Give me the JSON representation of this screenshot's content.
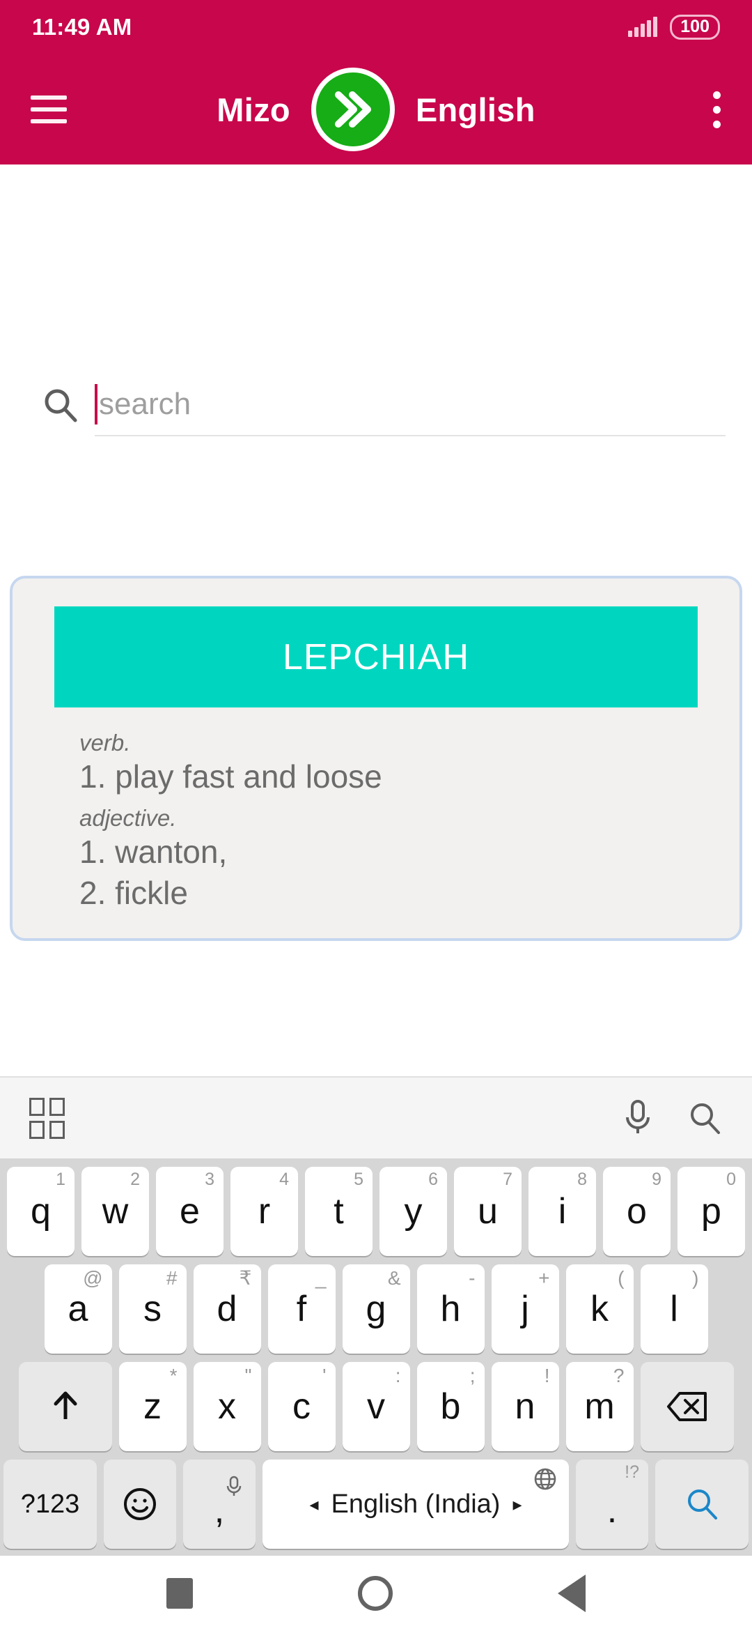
{
  "status_bar": {
    "time": "11:49 AM",
    "battery_level": "100",
    "signal_icon": "signal-bars-icon",
    "battery_icon": "battery-icon"
  },
  "app_bar": {
    "menu_icon": "hamburger-menu-icon",
    "source_language": "Mizo",
    "swap_icon": "double-chevron-right-icon",
    "target_language": "English",
    "overflow_icon": "more-vertical-icon",
    "background_color": "#c8064b",
    "swap_button_color": "#16ad16"
  },
  "search": {
    "icon": "search-icon",
    "placeholder": "search",
    "value": "",
    "caret_color": "#c8064b"
  },
  "result_card": {
    "headword": "LEPCHIAH",
    "header_color": "#00d6bf",
    "card_background": "#f2f1ef",
    "border_color": "#c6d7ef",
    "entries": [
      {
        "pos": "verb.",
        "senses": [
          "1. play fast and loose"
        ]
      },
      {
        "pos": "adjective.",
        "senses": [
          "1. wanton,",
          "2. fickle"
        ]
      }
    ]
  },
  "keyboard": {
    "toolbar": {
      "grid_icon": "grid-squares-icon",
      "mic_icon": "microphone-icon",
      "search_icon": "search-icon"
    },
    "row1": [
      {
        "key": "q",
        "hint": "1"
      },
      {
        "key": "w",
        "hint": "2"
      },
      {
        "key": "e",
        "hint": "3"
      },
      {
        "key": "r",
        "hint": "4"
      },
      {
        "key": "t",
        "hint": "5"
      },
      {
        "key": "y",
        "hint": "6"
      },
      {
        "key": "u",
        "hint": "7"
      },
      {
        "key": "i",
        "hint": "8"
      },
      {
        "key": "o",
        "hint": "9"
      },
      {
        "key": "p",
        "hint": "0"
      }
    ],
    "row2": [
      {
        "key": "a",
        "hint": "@"
      },
      {
        "key": "s",
        "hint": "#"
      },
      {
        "key": "d",
        "hint": "₹"
      },
      {
        "key": "f",
        "hint": "_"
      },
      {
        "key": "g",
        "hint": "&"
      },
      {
        "key": "h",
        "hint": "-"
      },
      {
        "key": "j",
        "hint": "+"
      },
      {
        "key": "k",
        "hint": "("
      },
      {
        "key": "l",
        "hint": ")"
      }
    ],
    "row3": [
      {
        "key": "z",
        "hint": "*"
      },
      {
        "key": "x",
        "hint": "\""
      },
      {
        "key": "c",
        "hint": "'"
      },
      {
        "key": "v",
        "hint": ":"
      },
      {
        "key": "b",
        "hint": ";"
      },
      {
        "key": "n",
        "hint": "!"
      },
      {
        "key": "m",
        "hint": "?"
      }
    ],
    "shift_icon": "shift-arrow-up-icon",
    "backspace_icon": "backspace-icon",
    "row4": {
      "symbols_label": "?123",
      "emoji_icon": "emoji-smiley-icon",
      "comma_label": ",",
      "comma_hint_icon": "microphone-icon",
      "space_label": "English (India)",
      "space_left_arrow": "◂",
      "space_right_arrow": "▸",
      "globe_icon": "globe-icon",
      "period_label": ".",
      "period_hint": "!?",
      "enter_icon": "search-enter-icon",
      "enter_color": "#1b87c9"
    }
  },
  "nav_bar": {
    "recents_icon": "recents-square-icon",
    "home_icon": "home-circle-icon",
    "back_icon": "back-triangle-icon"
  }
}
